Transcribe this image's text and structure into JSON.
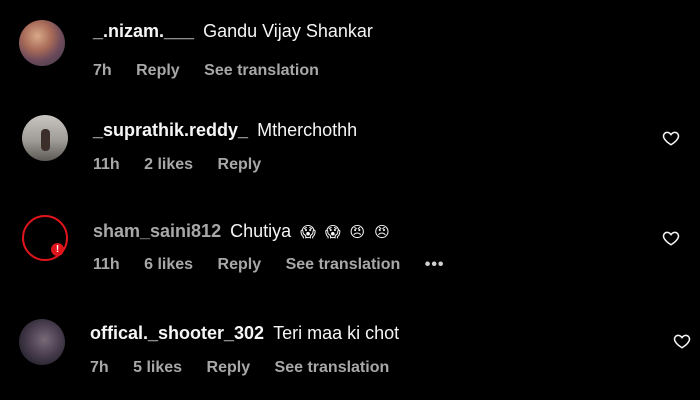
{
  "comments": [
    {
      "username": "_.nizam.___",
      "text": "Gandu Vijay Shankar",
      "time": "7h",
      "reply": "Reply",
      "translation": "See translation"
    },
    {
      "username": "_suprathik.reddy_",
      "text": "Mtherchothh",
      "time": "11h",
      "likes": "2 likes",
      "reply": "Reply"
    },
    {
      "username": "sham_saini812",
      "text": "Chutiya",
      "emojis": [
        "😱",
        "😱",
        "😠",
        "😠"
      ],
      "time": "11h",
      "likes": "6 likes",
      "reply": "Reply",
      "translation": "See translation",
      "more": "•••"
    },
    {
      "username": "offical._shooter_302",
      "text": "Teri maa ki chot",
      "time": "7h",
      "likes": "5 likes",
      "reply": "Reply",
      "translation": "See translation"
    }
  ],
  "colors": {
    "background": "#000000",
    "text": "#f5f5f5",
    "muted": "#a8a8a8",
    "alert": "#e0151c"
  },
  "icons": {
    "like": "heart-outline-icon",
    "more": "more-options-icon"
  }
}
